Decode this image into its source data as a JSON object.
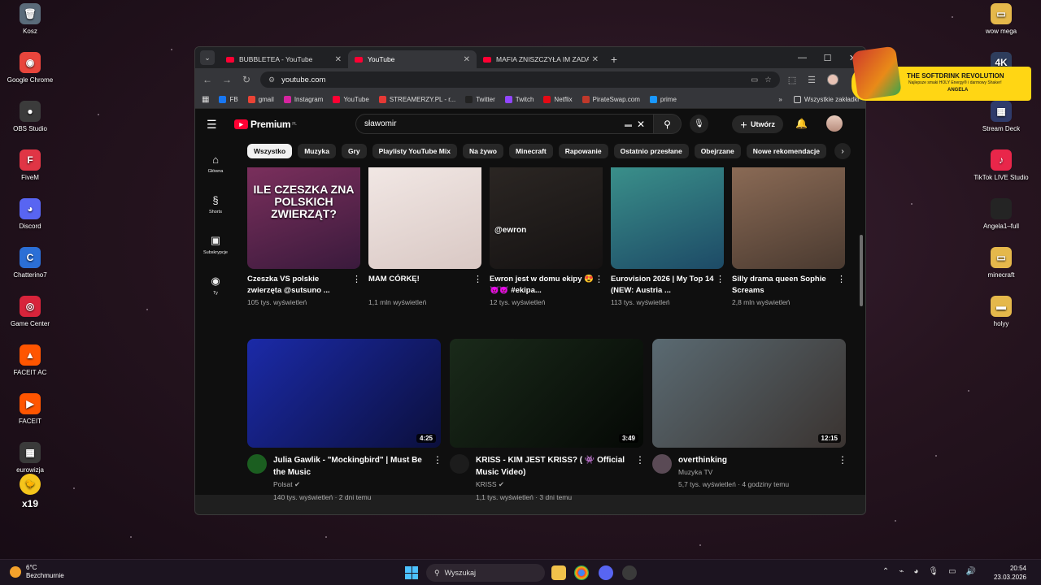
{
  "desktop": {
    "left_icons": [
      {
        "label": "Kosz",
        "color": "#5a6b7a",
        "glyph": "🗑"
      },
      {
        "label": "Google Chrome",
        "color": "#e8453c",
        "glyph": "◉"
      },
      {
        "label": "OBS Studio",
        "color": "#3b3b3b",
        "glyph": "●"
      },
      {
        "label": "FiveM",
        "color": "#e03545",
        "glyph": "F"
      },
      {
        "label": "Discord",
        "color": "#5865f2",
        "glyph": "◕"
      },
      {
        "label": "Chatterino7",
        "color": "#2b6fd6",
        "glyph": "C"
      },
      {
        "label": "Game Center",
        "color": "#d8243b",
        "glyph": "◎"
      },
      {
        "label": "FACEIT AC",
        "color": "#ff5500",
        "glyph": "▲"
      },
      {
        "label": "FACEIT",
        "color": "#ff5500",
        "glyph": "▶"
      },
      {
        "label": "eurowizja",
        "color": "#3a3a3a",
        "glyph": "▦"
      }
    ],
    "right_icons": [
      {
        "label": "wow mega",
        "color": "#e5b84b",
        "glyph": "▭"
      },
      {
        "label": "Elgato 4K Capture Utility",
        "color": "#2e3d5c",
        "glyph": "4K"
      },
      {
        "label": "Stream Deck",
        "color": "#2f3b6b",
        "glyph": "▦"
      },
      {
        "label": "TikTok LIVE Studio",
        "color": "#e9264a",
        "glyph": "♪"
      },
      {
        "label": "Angela1–full",
        "color": "#242424",
        "glyph": ""
      },
      {
        "label": "minecraft",
        "color": "#e5b84b",
        "glyph": "▭"
      },
      {
        "label": "holyy",
        "color": "#e5b84b",
        "glyph": "▬"
      }
    ],
    "sticker_text": "x19"
  },
  "browser": {
    "tabs": [
      {
        "title": "BUBBLETEA - YouTube",
        "active": false
      },
      {
        "title": "YouTube",
        "active": true
      },
      {
        "title": "MAFIA ZNISZCZYŁA IM ZADAN",
        "active": false
      }
    ],
    "url": "youtube.com",
    "bookmarks": [
      {
        "label": "FB",
        "color": "#1877f2"
      },
      {
        "label": "gmail",
        "color": "#ea4335"
      },
      {
        "label": "Instagram",
        "color": "#d6249f"
      },
      {
        "label": "YouTube",
        "color": "#ff0033"
      },
      {
        "label": "STREAMERZY.PL - r...",
        "color": "#e53935"
      },
      {
        "label": "Twitter",
        "color": "#222222"
      },
      {
        "label": "Twitch",
        "color": "#9146ff"
      },
      {
        "label": "Netflix",
        "color": "#e50914"
      },
      {
        "label": "PirateSwap.com",
        "color": "#c0392b"
      },
      {
        "label": "prime",
        "color": "#1a98ff"
      }
    ],
    "bookmarks_more": "»",
    "all_bookmarks": "Wszystkie zakładki"
  },
  "youtube": {
    "logo_text": "Premium",
    "logo_region": "PL",
    "search_value": "sławomir",
    "create_label": "Utwórz",
    "chips": [
      "Wszystko",
      "Muzyka",
      "Gry",
      "Playlisty YouTube Mix",
      "Na żywo",
      "Minecraft",
      "Rapowanie",
      "Ostatnio przesłane",
      "Obejrzane",
      "Nowe rekomendacje"
    ],
    "guide": [
      {
        "label": "Główna",
        "icon": "⌂"
      },
      {
        "label": "Shorts",
        "icon": "§"
      },
      {
        "label": "Subskrypcje",
        "icon": "▣"
      },
      {
        "label": "Ty",
        "icon": "◉"
      }
    ],
    "shorts": [
      {
        "title": "Czeszka VS polskie zwierzęta @sutsuno ...",
        "views": "105 tys. wyświetleń",
        "overlay": "ILE CZESZKA ZNA POLSKICH ZWIERZĄT?",
        "colors": [
          "#7a2f5c",
          "#3a1a3c"
        ]
      },
      {
        "title": "MAM CÓRKĘ!",
        "views": "1,1 mln wyświetleń",
        "overlay": "",
        "colors": [
          "#f1e7e4",
          "#d9c8c4"
        ]
      },
      {
        "title": "Ewron jest w domu ekipy 😍😈😈 #ekipa...",
        "views": "12 tys. wyświetleń",
        "overlay": "@ewron",
        "colors": [
          "#2b2623",
          "#151212"
        ]
      },
      {
        "title": "Eurovision 2026 | My Top 14 (NEW: Austria ...",
        "views": "113 tys. wyświetleń",
        "overlay": "",
        "colors": [
          "#3a8f8a",
          "#1d4a66"
        ]
      },
      {
        "title": "Silly drama queen Sophie Screams",
        "views": "2,8 mln wyświetleń",
        "overlay": "",
        "colors": [
          "#8a6a55",
          "#4a3a30"
        ]
      }
    ],
    "videos": [
      {
        "title": "Julia Gawlik - \"Mockingbird\" | Must Be the Music",
        "channel": "Polsat",
        "verified": true,
        "stats": "140 tys. wyświetleń · 2 dni temu",
        "duration": "4:25",
        "avatar_color": "#1b5e20",
        "colors": [
          "#1b2aa8",
          "#0b0f3c"
        ]
      },
      {
        "title": "KRISS - KIM JEST KRISS? ( 👾 Official Music Video)",
        "channel": "KRISS",
        "verified": true,
        "stats": "1,1 tys. wyświetleń · 3 dni temu",
        "duration": "3:49",
        "avatar_color": "#1c1c1c",
        "colors": [
          "#1a2a1a",
          "#050805"
        ]
      },
      {
        "title": "overthinking",
        "channel": "Muzyka TV",
        "verified": false,
        "stats": "5,7 tys. wyświetleń · 4 godziny temu",
        "duration": "12:15",
        "avatar_color": "#5a4a55",
        "colors": [
          "#5a6a72",
          "#3a3330"
        ]
      }
    ]
  },
  "promo": {
    "headline": "THE SOFTDRINK REVOLUTION",
    "sub": "Najlepsze smaki HOLY Energy® i darmowy Shaker!",
    "name": "ANGELA"
  },
  "taskbar": {
    "temperature": "6°C",
    "weather": "Bezchmurnie",
    "search_label": "Wyszukaj",
    "time": "20:54",
    "date": "23.03.2026"
  }
}
